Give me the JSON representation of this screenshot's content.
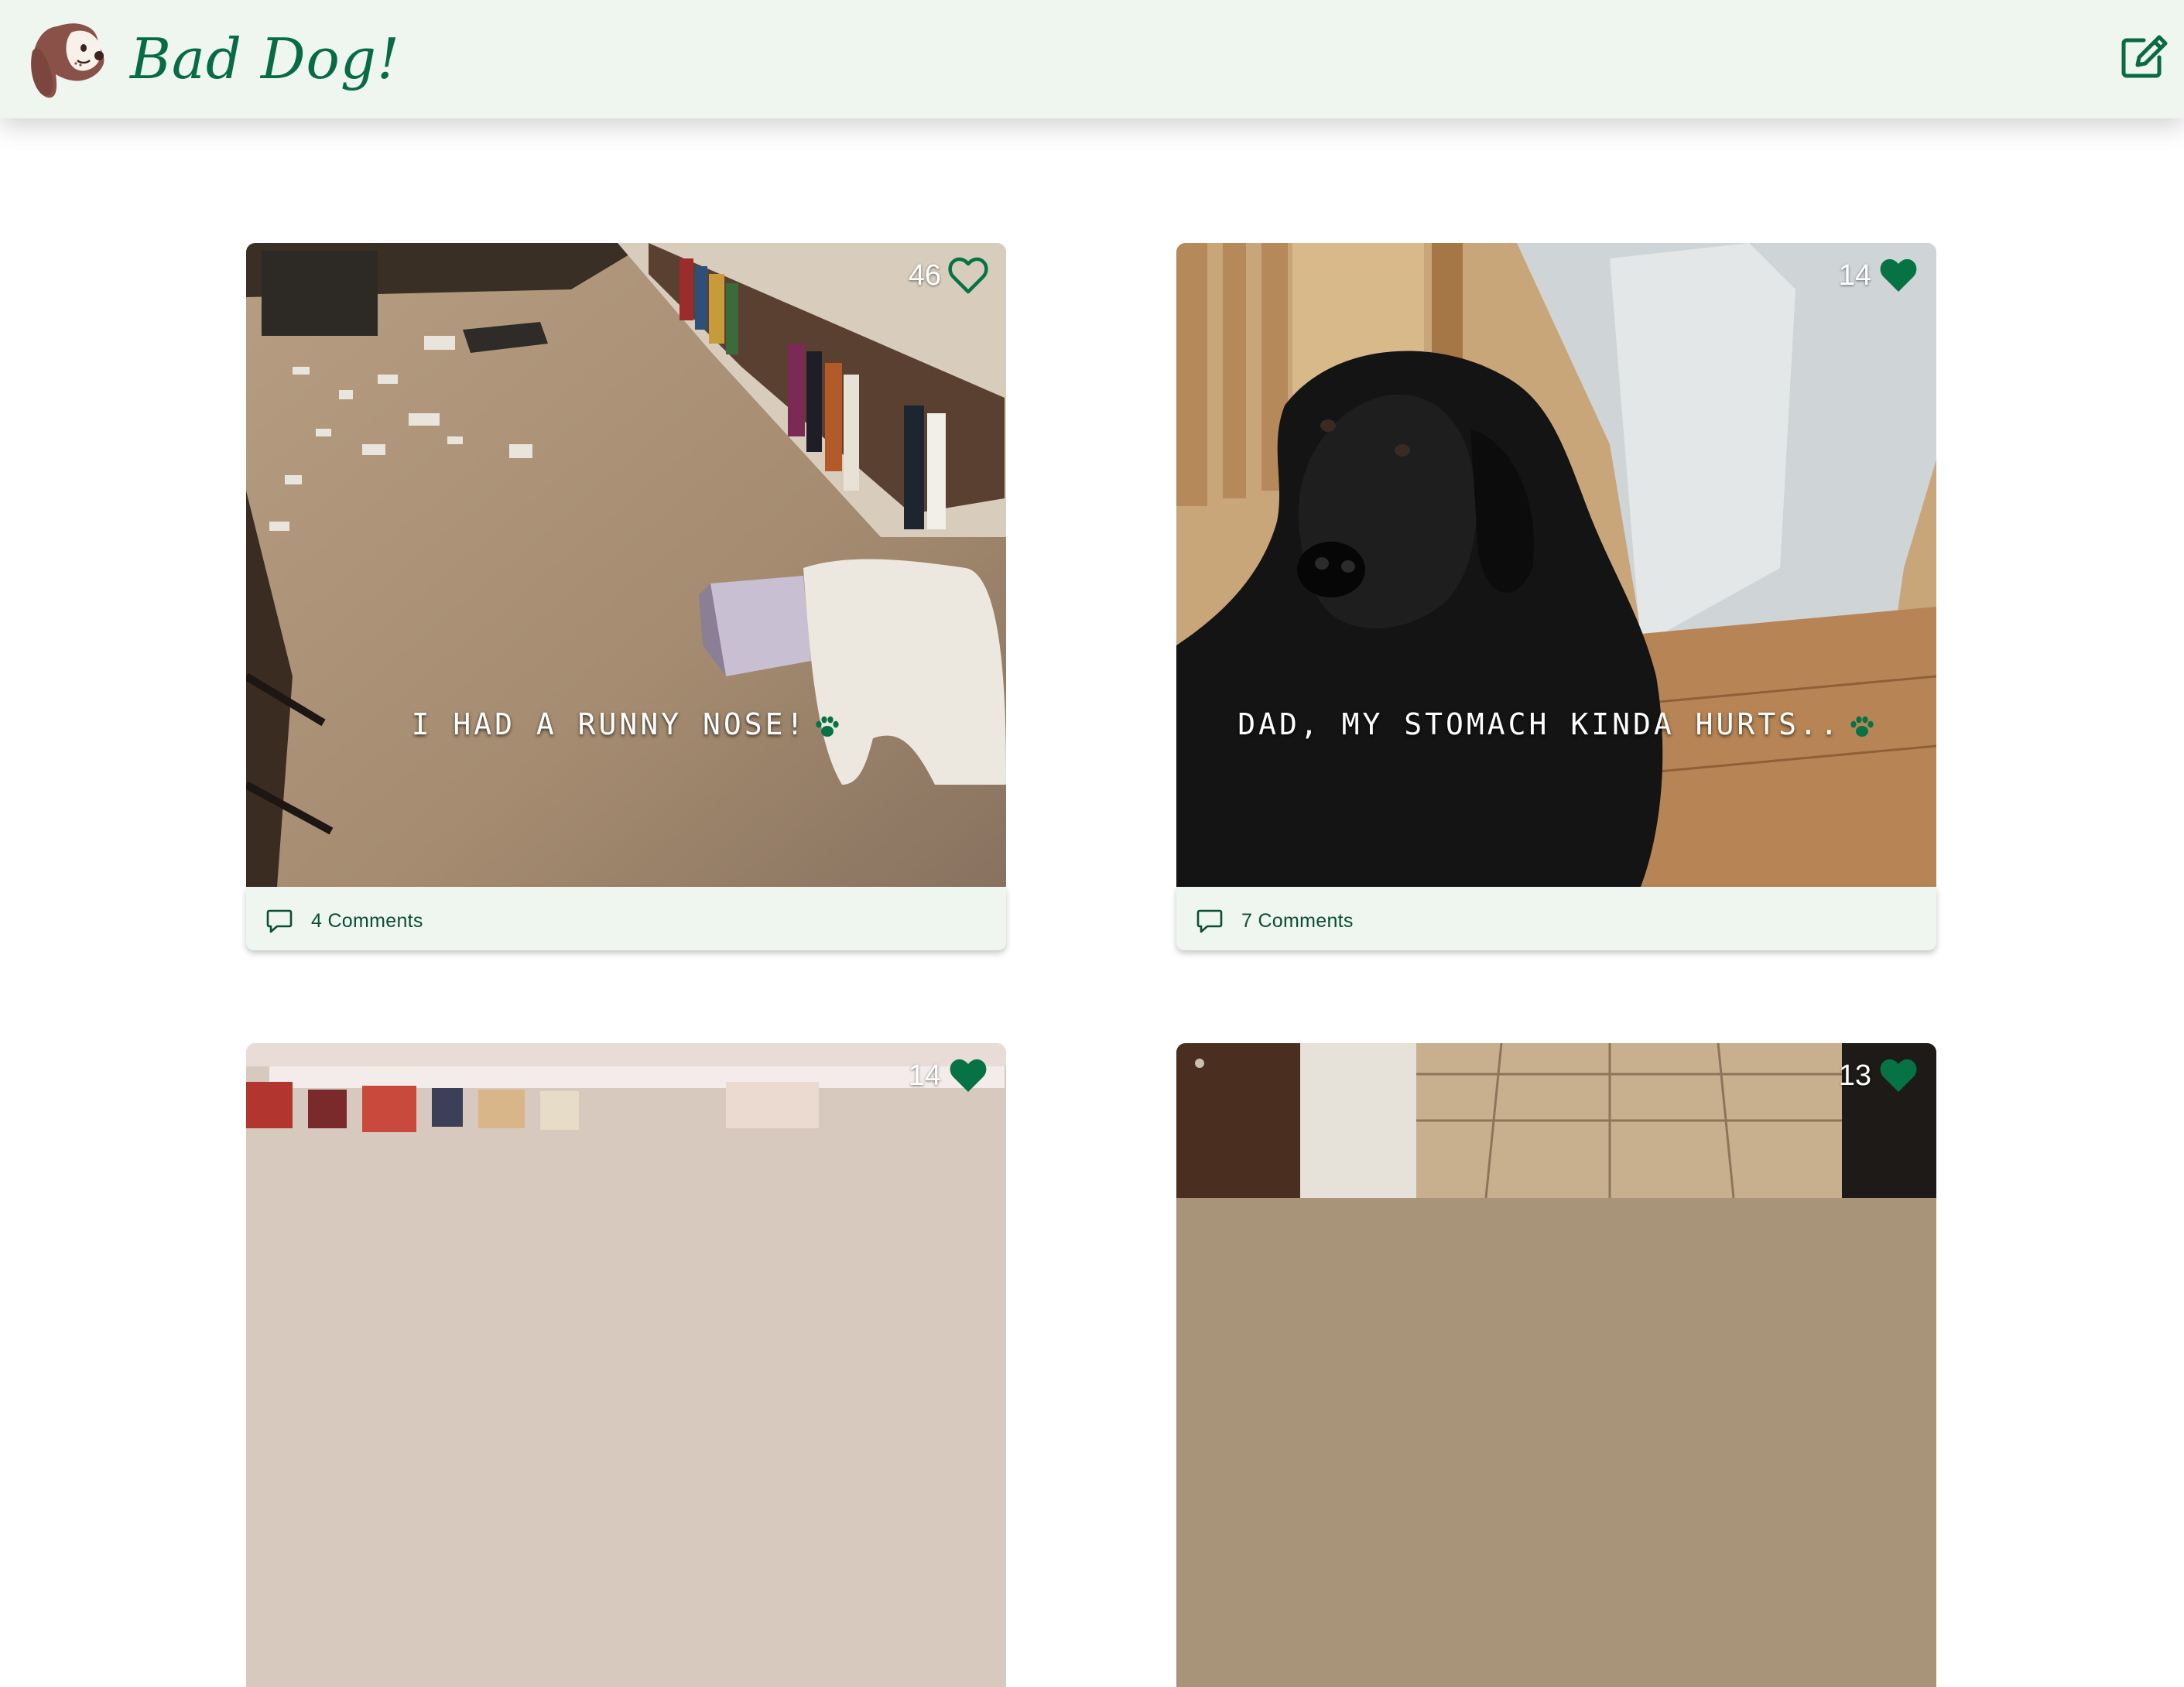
{
  "app": {
    "title": "Bad Dog!"
  },
  "colors": {
    "brand": "#076b46",
    "header_bg": "#eff5ef",
    "like_active": "#077345"
  },
  "posts": [
    {
      "caption": "I HAD A RUNNY NOSE!",
      "likes": "46",
      "liked": false,
      "comments": "4 Comments"
    },
    {
      "caption": "DAD, MY STOMACH KINDA HURTS..",
      "likes": "14",
      "liked": true,
      "comments": "7 Comments"
    },
    {
      "likes": "14",
      "liked": true
    },
    {
      "likes": "13",
      "liked": true
    }
  ]
}
